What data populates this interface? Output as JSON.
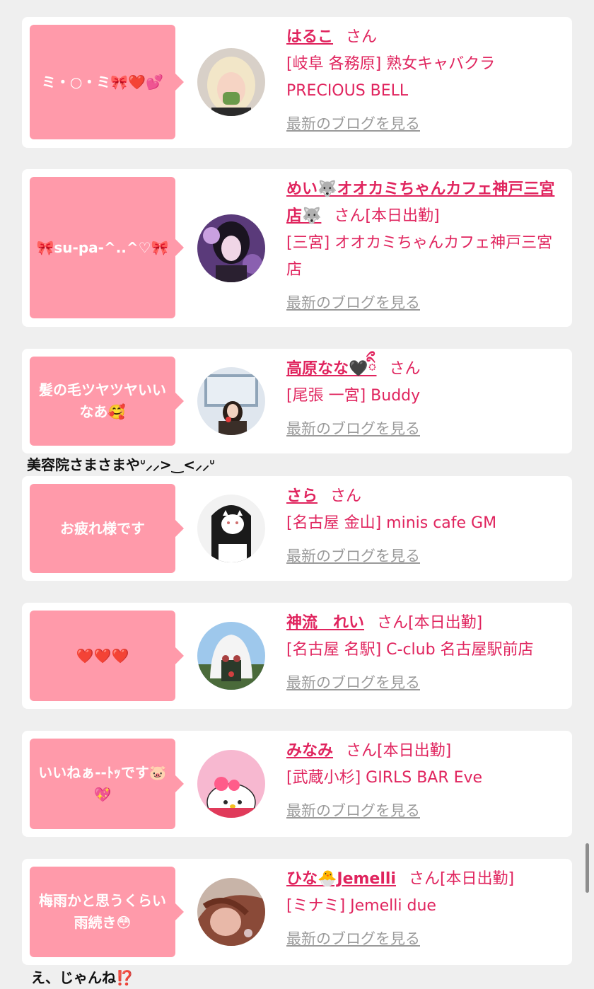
{
  "cards": [
    {
      "bubble": "ミ・○・ミ🎀❤️💕",
      "name": "はるこ",
      "suffix": "さん",
      "shop": "[岐阜 各務原]  熟女キャバクラ PRECIOUS BELL",
      "blog": "最新のブログを見る"
    },
    {
      "bubble": "🎀su-pa-^..^♡🎀",
      "name": "めい🐺オオカミちゃんカフェ神戸三宮店🐺",
      "suffix": "さん[本日出勤]",
      "shop": "[三宮] オオカミちゃんカフェ神戸三宮店",
      "blog": "最新のブログを見る"
    },
    {
      "bubble": "髪の毛ツヤツヤいいなあ🥰",
      "name": "高原なな🖤ིྀ",
      "suffix": "さん",
      "shop": "[尾張 一宮] Buddy",
      "blog": "最新のブログを見る",
      "below": "美容院さまさまやᐡ⸝⸝>‿<⸝⸝ᐡ"
    },
    {
      "bubble": "お疲れ様です",
      "name": "さら",
      "suffix": "さん",
      "shop": "[名古屋 金山] minis cafe GM",
      "blog": "最新のブログを見る"
    },
    {
      "bubble": "❤️❤️❤️",
      "name": "神流　れい",
      "suffix": "さん[本日出勤]",
      "shop": "[名古屋 名駅] C-club 名古屋駅前店",
      "blog": "最新のブログを見る"
    },
    {
      "bubble": "いいねぁ--ﾄｯです🐷💖",
      "name": "みなみ",
      "suffix": "さん[本日出勤]",
      "shop": "[武蔵小杉] GIRLS BAR Eve",
      "blog": "最新のブログを見る"
    },
    {
      "bubble": "梅雨かと思うくらい雨続き😳",
      "name": "ひな🐣Jemelli",
      "suffix": "さん[本日出勤]",
      "shop": "[ミナミ] Jemelli due",
      "blog": "最新のブログを見る",
      "below": "え、じゃんね⁉️"
    }
  ],
  "colors": {
    "background": "#efefef",
    "card": "#ffffff",
    "bubble": "#ff9aaa",
    "accent": "#e0245e",
    "link_gray": "#9a9a9a"
  }
}
